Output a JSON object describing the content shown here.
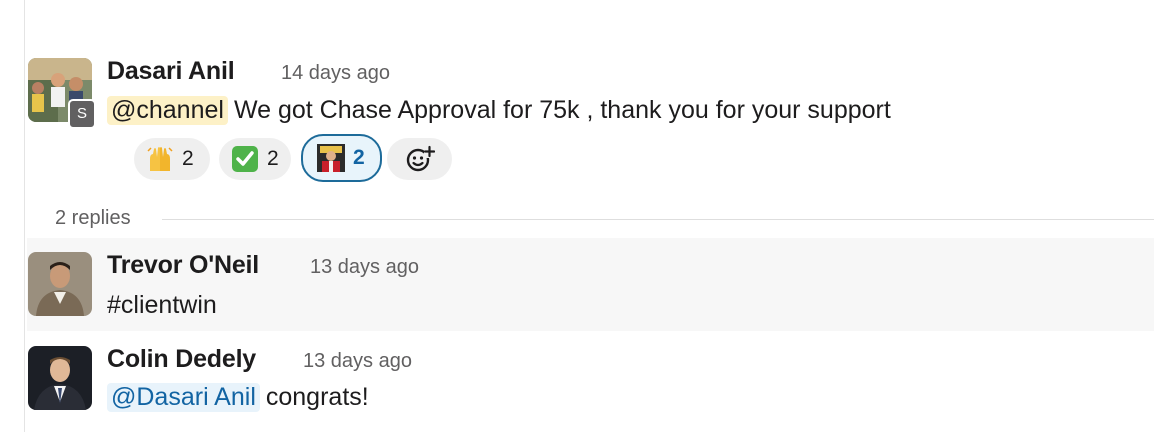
{
  "parent": {
    "author": "Dasari Anil",
    "time": "14 days ago",
    "badge": "S",
    "mention": "@channel",
    "text": "We got Chase Approval for 75k , thank you for your support",
    "reactions": [
      {
        "emoji": "raised-hands-emoji",
        "count": "2"
      },
      {
        "emoji": "check-mark-emoji",
        "count": "2"
      },
      {
        "emoji": "custom-portrait-emoji",
        "count": "2"
      }
    ]
  },
  "thread": {
    "replies_label": "2 replies"
  },
  "replies": [
    {
      "author": "Trevor O'Neil",
      "time": "13 days ago",
      "text": "#clientwin"
    },
    {
      "author": "Colin Dedely",
      "time": "13 days ago",
      "mention": "@Dasari Anil",
      "text": "congrats!"
    }
  ],
  "colors": {
    "mention_channel_bg": "#fdf1c7",
    "mention_user_bg": "#e8f3fb",
    "mention_user_text": "#1264a3",
    "active_reaction_border": "#1d6b9a"
  }
}
